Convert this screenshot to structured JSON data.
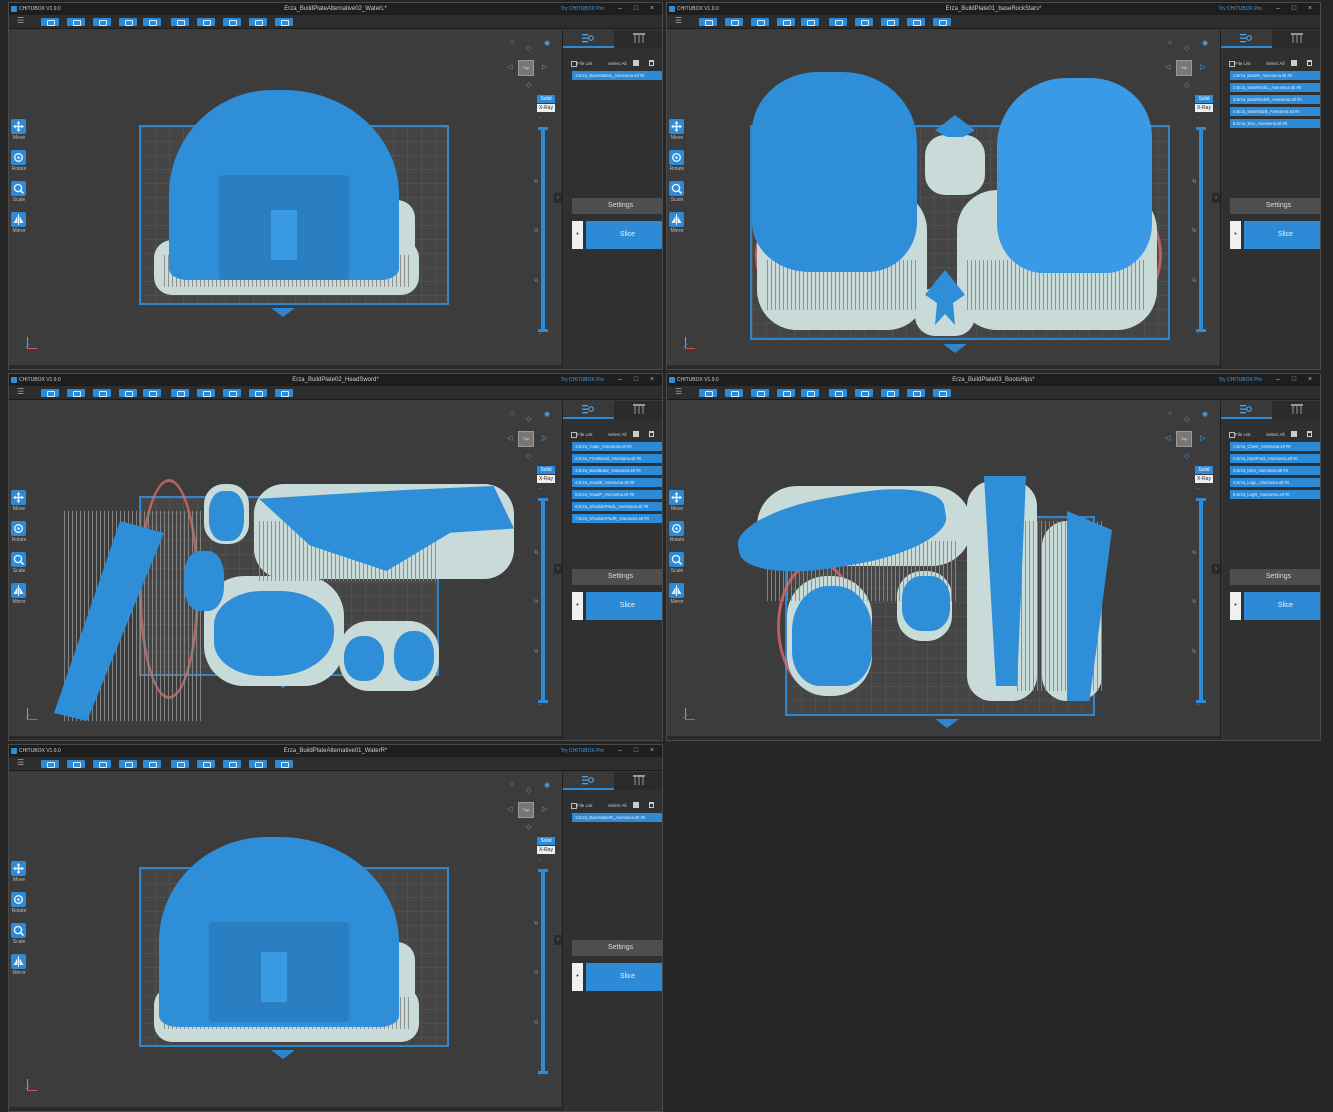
{
  "app": {
    "name": "CHITUBOX V1.9.0",
    "pro_link": "Try CHITUBOX Pro",
    "window_controls": [
      "–",
      "□",
      "×"
    ],
    "menu_icon": "menu-icon"
  },
  "toolbar_icons": [
    "open-file-icon",
    "save-icon",
    "cut-icon",
    "copy-icon",
    "paste-icon",
    "undo-icon",
    "redo-icon",
    "auto-layout-icon",
    "hollow-icon",
    "drill-icon",
    "support-icon",
    "camera-icon"
  ],
  "tools": {
    "move": "Move",
    "rotate": "Rotate",
    "scale": "Scale",
    "mirror": "Mirror"
  },
  "view": {
    "cube_label": "Top",
    "solid": "Solid",
    "xray": "X-Ray",
    "ticks": [
      "¾",
      "½",
      "¼"
    ],
    "up_arrow": "ˇ",
    "down_arrow": "ˆ"
  },
  "panel": {
    "file_list": "File List",
    "select_all": "Select All",
    "settings": "Settings",
    "slice": "Slice",
    "slice_mode": "•",
    "tab_model_icon": "model-settings-icon",
    "tab_support_icon": "support-tab-icon"
  },
  "colors": {
    "accent": "#2d8ad6",
    "model": "#2e8ed7",
    "raft": "#c8dbd8",
    "edge": "#e46a6a"
  },
  "windows": [
    {
      "title": "Erza_BuildPlateAlternative02_WaterL*",
      "files": [
        "1.Erza_BaseWaterL_Asensena.stl #0"
      ]
    },
    {
      "title": "Erza_BuildPlate01_baseRockStars*",
      "files": [
        "1.Erza_BaseR_Asensena.stl #0",
        "2.Erza_BaseRockL_Asensena.stl #0",
        "3.Erza_BaseRockR_Asensena.stl #0",
        "4.Erza_BaseStarB_Asensena.stl #0",
        "5.Erza_Star_Asensena.stl #0"
      ]
    },
    {
      "title": "Erza_BuildPlate02_HeadSword*",
      "files": [
        "1.Erza_Cape_Asensena.stl #0",
        "2.Erza_FrontBraid_Asensena.stl #0",
        "3.Erza_BackBraid_Asensena.stl #0",
        "4.Erza_HeadB_Asensena.stl #0",
        "5.Erza_HeadF_Asensena.stl #0",
        "6.Erza_ShoulderPadL_Asensena.stl #0",
        "7.Erza_ShoulderPadR_Asensena.stl #0"
      ]
    },
    {
      "title": "Erza_BuildPlate03_BootsHips*",
      "files": [
        "1.Erza_Chest_Asensena.stl #0",
        "2.Erza_HipsFront_Asensena.stl #0",
        "3.Erza_Hips_Asensena.stl #0",
        "4.Erza_LegL_Asensena.stl #0",
        "5.Erza_LegR_Asensena.stl #0"
      ]
    },
    {
      "title": "Erza_BuildPlateAlternative01_WaterR*",
      "files": [
        "1.Erza_BaseWaterR_Asensena.stl #0"
      ]
    }
  ]
}
